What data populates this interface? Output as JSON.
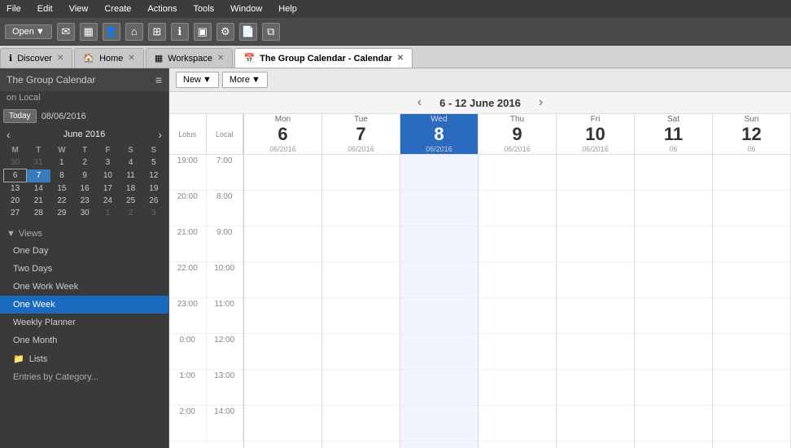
{
  "menubar": {
    "items": [
      "File",
      "Edit",
      "View",
      "Create",
      "Actions",
      "Tools",
      "Window",
      "Help"
    ]
  },
  "toolbar": {
    "open_label": "Open",
    "icons": [
      "envelope",
      "calendar-grid",
      "person",
      "home",
      "apps",
      "info",
      "monitor",
      "wrench",
      "document",
      "copy"
    ]
  },
  "tabs": [
    {
      "id": "discover",
      "label": "Discover",
      "icon": "ℹ",
      "active": false,
      "closable": true
    },
    {
      "id": "home",
      "label": "Home",
      "icon": "🏠",
      "active": false,
      "closable": true
    },
    {
      "id": "workspace",
      "label": "Workspace",
      "icon": "▦",
      "active": false,
      "closable": true
    },
    {
      "id": "group-calendar",
      "label": "The Group Calendar - Calendar",
      "icon": "📅",
      "active": true,
      "closable": true
    }
  ],
  "sidebar": {
    "title": "The Group Calendar",
    "subtitle": "on Local",
    "hamburger": "≡",
    "today_btn": "Today",
    "today_date": "08/06/2016",
    "calendar": {
      "month": "June",
      "year": "2016",
      "day_headers": [
        "M",
        "T",
        "W",
        "T",
        "F",
        "S",
        "S"
      ],
      "weeks": [
        [
          {
            "d": "30",
            "other": true
          },
          {
            "d": "31",
            "other": true
          },
          {
            "d": "1"
          },
          {
            "d": "2"
          },
          {
            "d": "3"
          },
          {
            "d": "4"
          },
          {
            "d": "5"
          }
        ],
        [
          {
            "d": "6",
            "highlight": true
          },
          {
            "d": "7",
            "today": true
          },
          {
            "d": "8"
          },
          {
            "d": "9"
          },
          {
            "d": "10"
          },
          {
            "d": "11"
          },
          {
            "d": "12"
          }
        ],
        [
          {
            "d": "13"
          },
          {
            "d": "14"
          },
          {
            "d": "15"
          },
          {
            "d": "16"
          },
          {
            "d": "17"
          },
          {
            "d": "18"
          },
          {
            "d": "19"
          }
        ],
        [
          {
            "d": "20"
          },
          {
            "d": "21"
          },
          {
            "d": "22"
          },
          {
            "d": "23"
          },
          {
            "d": "24"
          },
          {
            "d": "25"
          },
          {
            "d": "26"
          }
        ],
        [
          {
            "d": "27"
          },
          {
            "d": "28"
          },
          {
            "d": "29"
          },
          {
            "d": "30"
          },
          {
            "d": "1",
            "other": true
          },
          {
            "d": "2",
            "other": true
          },
          {
            "d": "3",
            "other": true
          }
        ]
      ]
    },
    "views_label": "Views",
    "views": [
      {
        "id": "one-day",
        "label": "One Day",
        "active": false
      },
      {
        "id": "two-days",
        "label": "Two Days",
        "active": false
      },
      {
        "id": "one-work-week",
        "label": "One Work Week",
        "active": false
      },
      {
        "id": "one-week",
        "label": "One Week",
        "active": true
      },
      {
        "id": "weekly-planner",
        "label": "Weekly Planner",
        "active": false
      },
      {
        "id": "one-month",
        "label": "One Month",
        "active": false
      }
    ],
    "lists_label": "Lists",
    "entries_label": "Entries by Category..."
  },
  "content": {
    "new_btn": "New",
    "more_btn": "More",
    "nav_title": "6 - 12 June 2016",
    "col_lotus": "Lotus",
    "col_local": "Local",
    "days": [
      {
        "num": "6",
        "name": "Mon",
        "date": "06/2016",
        "today": false
      },
      {
        "num": "7",
        "name": "Tue",
        "date": "06/2016",
        "today": false
      },
      {
        "num": "8",
        "name": "Wed",
        "date": "06/2016",
        "today": true
      },
      {
        "num": "9",
        "name": "Thu",
        "date": "06/2016",
        "today": false
      },
      {
        "num": "10",
        "name": "Fri",
        "date": "06/2016",
        "today": false
      },
      {
        "num": "11",
        "name": "Sat",
        "date": "06",
        "today": false
      },
      {
        "num": "12",
        "name": "Sun",
        "date": "06",
        "today": false
      }
    ],
    "lotus_times": [
      "19:00",
      "20:00",
      "21:00",
      "22:00",
      "23:00",
      "0:00",
      "1:00",
      "2:00"
    ],
    "local_times": [
      "7:00",
      "8:00",
      "9:00",
      "10:00",
      "11:00",
      "12:00",
      "13:00",
      "14:00"
    ]
  }
}
